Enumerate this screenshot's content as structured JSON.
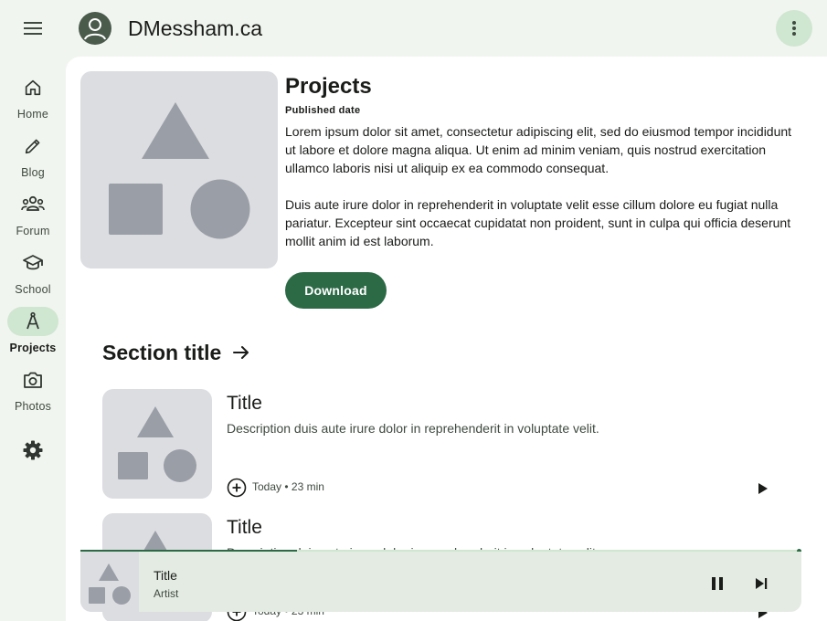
{
  "header": {
    "site_title": "DMessham.ca",
    "menu_icon": "menu-icon",
    "avatar_icon": "account-icon",
    "more_icon": "more-vert-icon"
  },
  "rail": {
    "items": [
      {
        "label": "Home",
        "icon": "home-icon",
        "active": false
      },
      {
        "label": "Blog",
        "icon": "pencil-icon",
        "active": false
      },
      {
        "label": "Forum",
        "icon": "groups-icon",
        "active": false
      },
      {
        "label": "School",
        "icon": "school-icon",
        "active": false
      },
      {
        "label": "Projects",
        "icon": "compass-icon",
        "active": true
      },
      {
        "label": "Photos",
        "icon": "camera-icon",
        "active": false
      }
    ],
    "settings_icon": "gear-icon"
  },
  "hero": {
    "title": "Projects",
    "date_label": "Published date",
    "paragraph_1": "Lorem ipsum dolor sit amet, consectetur adipiscing elit, sed do eiusmod tempor incididunt ut labore et dolore magna aliqua. Ut enim ad minim veniam, quis nostrud exercitation ullamco laboris nisi ut aliquip ex ea commodo consequat.",
    "paragraph_2": "Duis aute irure dolor in reprehenderit in voluptate velit esse cillum dolore eu fugiat nulla pariatur. Excepteur sint occaecat cupidatat non proident, sunt in culpa qui officia deserunt mollit anim id est laborum.",
    "download_label": "Download"
  },
  "section": {
    "title": "Section title",
    "cards": [
      {
        "title": "Title",
        "description": "Description duis aute irure dolor in reprehenderit in voluptate velit.",
        "meta": "Today • 23 min"
      },
      {
        "title": "Title",
        "description": "Description duis aute irure dolor in reprehenderit in voluptate velit.",
        "meta": "Today • 23 min"
      }
    ]
  },
  "player": {
    "title": "Title",
    "artist": "Artist",
    "progress": 0.3,
    "pause_icon": "pause-icon",
    "next_icon": "skip-next-icon"
  },
  "colors": {
    "primary": "#2c6a46",
    "secondary_container": "#cfe6d1",
    "background": "#f1f5ef",
    "placeholder": "#dcdde1",
    "placeholder_shape": "#9a9ea6"
  }
}
